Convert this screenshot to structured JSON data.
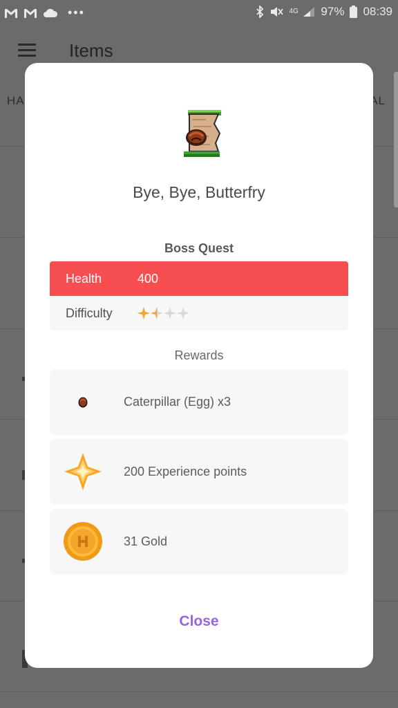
{
  "status_bar": {
    "battery": "97%",
    "time": "08:39",
    "network": "4G"
  },
  "app": {
    "title": "Items",
    "tab_left_partial": "HA",
    "tab_right_partial": "AL"
  },
  "dialog": {
    "quest_icon": "scroll-quest-icon",
    "quest_name": "Bye, Bye, Butterfry",
    "section_title": "Boss Quest",
    "stats": {
      "health_label": "Health",
      "health_value": "400",
      "difficulty_label": "Difficulty",
      "difficulty_value": 1.5,
      "difficulty_max": 4
    },
    "rewards_title": "Rewards",
    "rewards": [
      {
        "icon": "egg-icon",
        "label": "Caterpillar (Egg) x3"
      },
      {
        "icon": "experience-star-icon",
        "label": "200 Experience points"
      },
      {
        "icon": "gold-coin-icon",
        "label": "31 Gold"
      }
    ],
    "close_label": "Close"
  },
  "colors": {
    "health_bar": "#f74e52",
    "accent_purple": "#9a62e1",
    "star_gold": "#f4a52b",
    "star_empty": "#d8d8d8",
    "overlay": "#6b6b6b"
  }
}
